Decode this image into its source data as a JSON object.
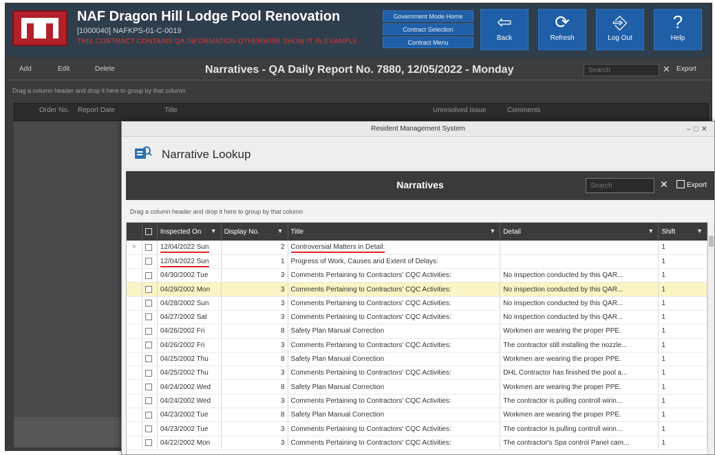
{
  "app": {
    "title": "NAF Dragon Hill Lodge Pool Renovation",
    "subtitle": "[1000040] NAFKPS-01-C-0019",
    "warning": "THIS CONTRACT CONTAINS QA INFORMATION OTHERWISE SHOW IT IN EXAMPLE",
    "nav_links": [
      "Government Mode Home",
      "Contract Selection",
      "Contract Menu"
    ],
    "tool_buttons": [
      {
        "label": "Back",
        "icon": "back-arrow-icon",
        "glyph": "⇦"
      },
      {
        "label": "Refresh",
        "icon": "refresh-icon",
        "glyph": "⟳"
      },
      {
        "label": "Log Out",
        "icon": "logout-icon",
        "glyph": "⎆"
      },
      {
        "label": "Help",
        "icon": "help-icon",
        "glyph": "?"
      }
    ],
    "toolbar": {
      "add": "Add",
      "edit": "Edit",
      "delete": "Delete",
      "title": "Narratives - QA Daily Report No. 7880, 12/05/2022 - Monday",
      "search_placeholder": "Search",
      "export": "Export"
    },
    "group_hint": "Drag a column header and drop it here to group by that column",
    "bg_columns": [
      "Order No.",
      "Report Date",
      "Title",
      "Unresolved Issue",
      "Comments"
    ]
  },
  "dialog": {
    "window_title": "Resident Management System",
    "heading": "Narrative Lookup",
    "grid_title": "Narratives",
    "search_placeholder": "Search",
    "export_label": "Export",
    "drag_hint": "Drag a column header and drop it here to group by that column",
    "columns": [
      "Inspected On",
      "Display No.",
      "Title",
      "Detail",
      "Shift"
    ],
    "rows": [
      {
        "date": "12/04/2022 Sun",
        "no": "2",
        "title": "Controversial Matters in Detail:",
        "detail": "",
        "shift": "1"
      },
      {
        "date": "12/04/2022 Sun",
        "no": "1",
        "title": "Progress of Work, Causes and Extent of Delays:",
        "detail": "",
        "shift": "1"
      },
      {
        "date": "04/30/2002 Tue",
        "no": "3",
        "title": "Comments Pertaining to Contractors' CQC Activities:",
        "detail": "No inspection conducted by this QAR...",
        "shift": "1"
      },
      {
        "date": "04/29/2002 Mon",
        "no": "3",
        "title": "Comments Pertaining to Contractors' CQC Activities:",
        "detail": "No inspection conducted by this QAR...",
        "shift": "1"
      },
      {
        "date": "04/28/2002 Sun",
        "no": "3",
        "title": "Comments Pertaining to Contractors' CQC Activities:",
        "detail": "No inspection conducted by this QAR...",
        "shift": "1"
      },
      {
        "date": "04/27/2002 Sat",
        "no": "3",
        "title": "Comments Pertaining to Contractors' CQC Activities:",
        "detail": "No inspection conducted by this QAR...",
        "shift": "1"
      },
      {
        "date": "04/26/2002 Fri",
        "no": "8",
        "title": "Safety Plan Manual Correction",
        "detail": "Workmen are wearing the proper PPE.",
        "shift": "1"
      },
      {
        "date": "04/26/2002 Fri",
        "no": "3",
        "title": "Comments Pertaining to Contractors' CQC Activities:",
        "detail": "The contractor still installing the nozzle...",
        "shift": "1"
      },
      {
        "date": "04/25/2002 Thu",
        "no": "8",
        "title": "Safety Plan Manual Correction",
        "detail": "Workmen are wearing the proper PPE.",
        "shift": "1"
      },
      {
        "date": "04/25/2002 Thu",
        "no": "3",
        "title": "Comments Pertaining to Contractors' CQC Activities:",
        "detail": "DHL Contractor has finished the pool a...",
        "shift": "1"
      },
      {
        "date": "04/24/2002 Wed",
        "no": "8",
        "title": "Safety Plan Manual Correction",
        "detail": "Workmen are wearing the proper PPE.",
        "shift": "1"
      },
      {
        "date": "04/24/2002 Wed",
        "no": "3",
        "title": "Comments Pertaining to Contractors' CQC Activities:",
        "detail": "The contractor is pulling controll wirin...",
        "shift": "1"
      },
      {
        "date": "04/23/2002 Tue",
        "no": "8",
        "title": "Safety Plan Manual Correction",
        "detail": "Workmen are wearing the proper PPE.",
        "shift": "1"
      },
      {
        "date": "04/23/2002 Tue",
        "no": "3",
        "title": "Comments Pertaining to Contractors' CQC Activities:",
        "detail": "The contractor is pulling controll wirin...",
        "shift": "1"
      },
      {
        "date": "04/22/2002 Mon",
        "no": "3",
        "title": "Comments Pertaining to Contractors' CQC Activities:",
        "detail": "The contractor's Spa control Panel cam...",
        "shift": "1"
      }
    ],
    "selected_row_indicator": ">",
    "highlighted_row": 3,
    "underlined_rows": [
      0,
      1
    ],
    "colors": {
      "highlight": "#fbf4c4",
      "underline": "#e02020",
      "header_bg": "#3b3b3b"
    }
  }
}
